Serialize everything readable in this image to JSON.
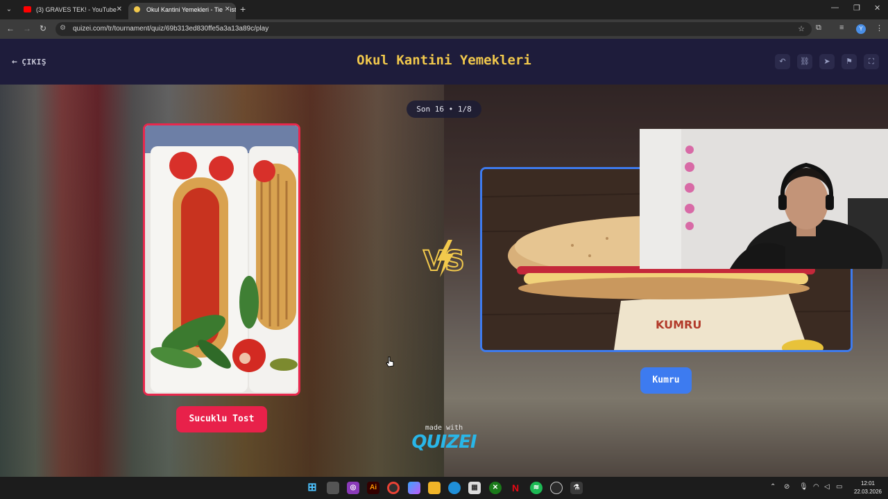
{
  "browser": {
    "tabs": [
      {
        "label": "(3) GRAVES TEK! - YouTube",
        "active": false
      },
      {
        "label": "Okul Kantini Yemekleri - Tier List",
        "active": true
      }
    ],
    "url": "quizei.com/tr/tournament/quiz/69b313ed830ffe5a3a13a89c/play",
    "profile_initial": "Y"
  },
  "header": {
    "back_label": "ÇIKIŞ",
    "title": "Okul Kantini Yemekleri",
    "tools": [
      "undo-icon",
      "link-icon",
      "send-icon",
      "flag-icon",
      "fullscreen-icon"
    ]
  },
  "round": {
    "label": "Son 16 • 1/8"
  },
  "matchup": {
    "left": {
      "name": "Sucuklu Tost",
      "color": "#e8214a"
    },
    "right": {
      "name": "Kumru",
      "color": "#3d7bf0"
    },
    "vs_icon": "vs-lightning-icon"
  },
  "footer": {
    "made_with": "made with",
    "brand": "QUIZEI"
  },
  "taskbar": {
    "apps": [
      "windows-start-icon",
      "task-view-icon",
      "instagram-icon",
      "illustrator-icon",
      "chrome-icon",
      "copilot-icon",
      "file-explorer-icon",
      "edge-icon",
      "store-icon",
      "xbox-icon",
      "netflix-icon",
      "spotify-icon",
      "steam-icon",
      "app-icon"
    ],
    "time": "12:01",
    "date": "22.03.2026"
  }
}
